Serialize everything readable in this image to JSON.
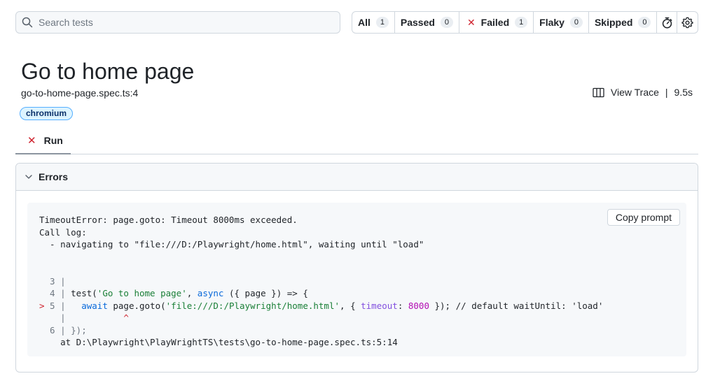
{
  "search": {
    "placeholder": "Search tests"
  },
  "filters": [
    {
      "label": "All",
      "count": "1"
    },
    {
      "label": "Passed",
      "count": "0"
    },
    {
      "label": "Failed",
      "count": "1"
    },
    {
      "label": "Flaky",
      "count": "0"
    },
    {
      "label": "Skipped",
      "count": "0"
    }
  ],
  "toolbar_icons": [
    "stopwatch-icon",
    "gear-icon"
  ],
  "test": {
    "title": "Go to home page",
    "location": "go-to-home-page.spec.ts:4",
    "trace_label": "View Trace",
    "separator": "|",
    "duration": "9.5s",
    "project": "chromium"
  },
  "tabs": [
    {
      "label": "Run",
      "status": "failed"
    }
  ],
  "errors": {
    "header": "Errors",
    "copy_label": "Copy prompt",
    "message": "TimeoutError: page.goto: Timeout 8000ms exceeded.",
    "call_log_header": "Call log:",
    "call_log_item": "  - navigating to \"file:///D:/Playwright/home.html\", waiting until \"load\"",
    "code": {
      "line3_prefix": "  3 |",
      "line4_prefix": "  4 | ",
      "line4_test": "test(",
      "line4_string": "'Go to home page'",
      "line4_comma": ", ",
      "line4_async": "async",
      "line4_rest": " ({ page }) => {",
      "line5_marker": ">",
      "line5_prefix": " 5 |   ",
      "line5_await": "await",
      "line5_call": " page.goto(",
      "line5_string": "'file:///D:/Playwright/home.html'",
      "line5_sep": ", { ",
      "line5_key": "timeout",
      "line5_colon": ": ",
      "line5_num": "8000",
      "line5_close": " }); ",
      "line5_comment": "// default waitUntil: 'load'",
      "caret_prefix": "    |           ",
      "caret": "^",
      "line6": "  6 | });",
      "stack": "    at D:\\Playwright\\PlayWrightTS\\tests\\go-to-home-page.spec.ts:5:14"
    }
  },
  "colors": {
    "failed": "#cf222e",
    "badge_border": "#54aeff",
    "badge_bg": "#ddf4ff",
    "string": "#1a7f37",
    "keyword": "#0969da",
    "number": "#b30cb3"
  }
}
